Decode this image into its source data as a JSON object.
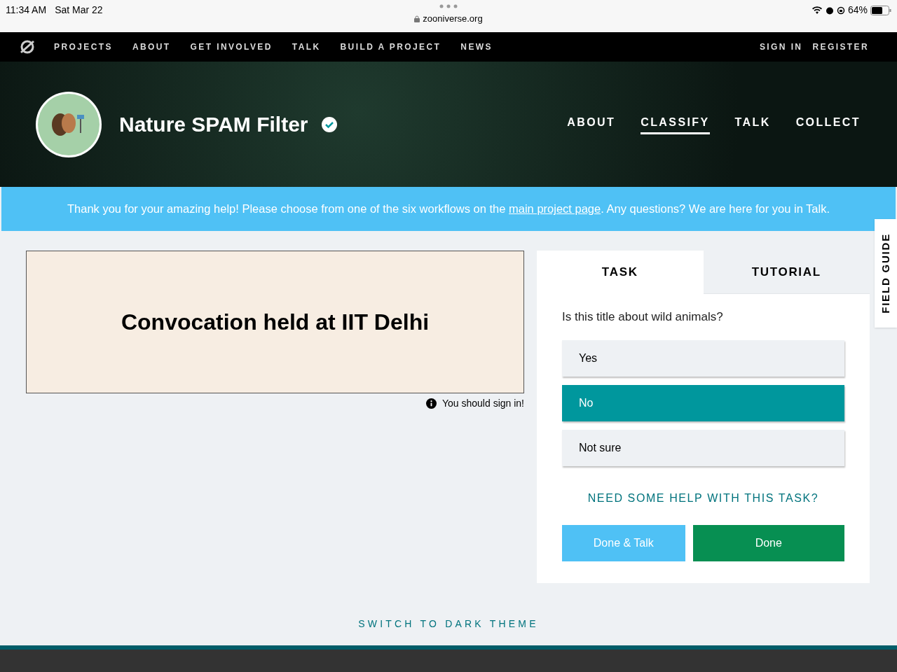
{
  "status_bar": {
    "time": "11:34 AM",
    "date": "Sat Mar 22",
    "url": "zooniverse.org",
    "battery": "64%"
  },
  "site_nav": {
    "items": [
      "PROJECTS",
      "ABOUT",
      "GET INVOLVED",
      "TALK",
      "BUILD A PROJECT",
      "NEWS"
    ],
    "account": [
      "SIGN IN",
      "REGISTER"
    ]
  },
  "project": {
    "title": "Nature SPAM Filter",
    "verified": true,
    "tabs": [
      {
        "label": "ABOUT",
        "selected": false
      },
      {
        "label": "CLASSIFY",
        "selected": true
      },
      {
        "label": "TALK",
        "selected": false
      },
      {
        "label": "COLLECT",
        "selected": false
      }
    ]
  },
  "banner": {
    "before": "Thank you for your amazing help! Please choose from one of the six workflows on the ",
    "link": "main project page",
    "after": ". Any questions? We are here for you in Talk."
  },
  "subject": {
    "text": "Convocation held at IIT Delhi",
    "note": "You should sign in!"
  },
  "task_panel": {
    "tabs": [
      {
        "label": "TASK",
        "selected": true
      },
      {
        "label": "TUTORIAL",
        "selected": false
      }
    ],
    "question": "Is this title about wild animals?",
    "answers": [
      {
        "label": "Yes",
        "selected": false
      },
      {
        "label": "No",
        "selected": true
      },
      {
        "label": "Not sure",
        "selected": false
      }
    ],
    "help": "NEED SOME HELP WITH THIS TASK?",
    "buttons": [
      {
        "label": "Done & Talk",
        "kind": "secondary"
      },
      {
        "label": "Done",
        "kind": "primary"
      }
    ]
  },
  "field_guide": "FIELD GUIDE",
  "theme_toggle": "SWITCH TO DARK THEME"
}
